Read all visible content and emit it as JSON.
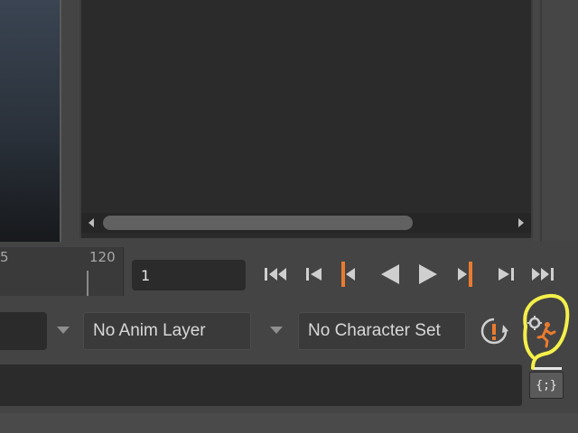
{
  "viewport": {
    "label": ""
  },
  "time_ruler": {
    "labels": [
      "5",
      "120"
    ],
    "current_frame": "1"
  },
  "playback": {
    "buttons": [
      {
        "name": "go-to-start",
        "icon": "skip-to-start-icon"
      },
      {
        "name": "step-back-frame",
        "icon": "step-back-icon"
      },
      {
        "name": "step-back-key",
        "icon": "step-back-key-icon"
      },
      {
        "name": "play-backwards",
        "icon": "play-backwards-icon"
      },
      {
        "name": "play-forwards",
        "icon": "play-forwards-icon"
      },
      {
        "name": "step-forward-key",
        "icon": "step-forward-key-icon"
      },
      {
        "name": "step-forward-frame",
        "icon": "step-forward-icon"
      },
      {
        "name": "go-to-end",
        "icon": "skip-to-end-icon"
      }
    ],
    "accent_color": "#e97b2e"
  },
  "anim_layer": {
    "value": "No Anim Layer"
  },
  "character_set": {
    "value": "No Character Set"
  },
  "script_editor": {
    "label": "{;}"
  },
  "annotation_color": "#f4f04a"
}
